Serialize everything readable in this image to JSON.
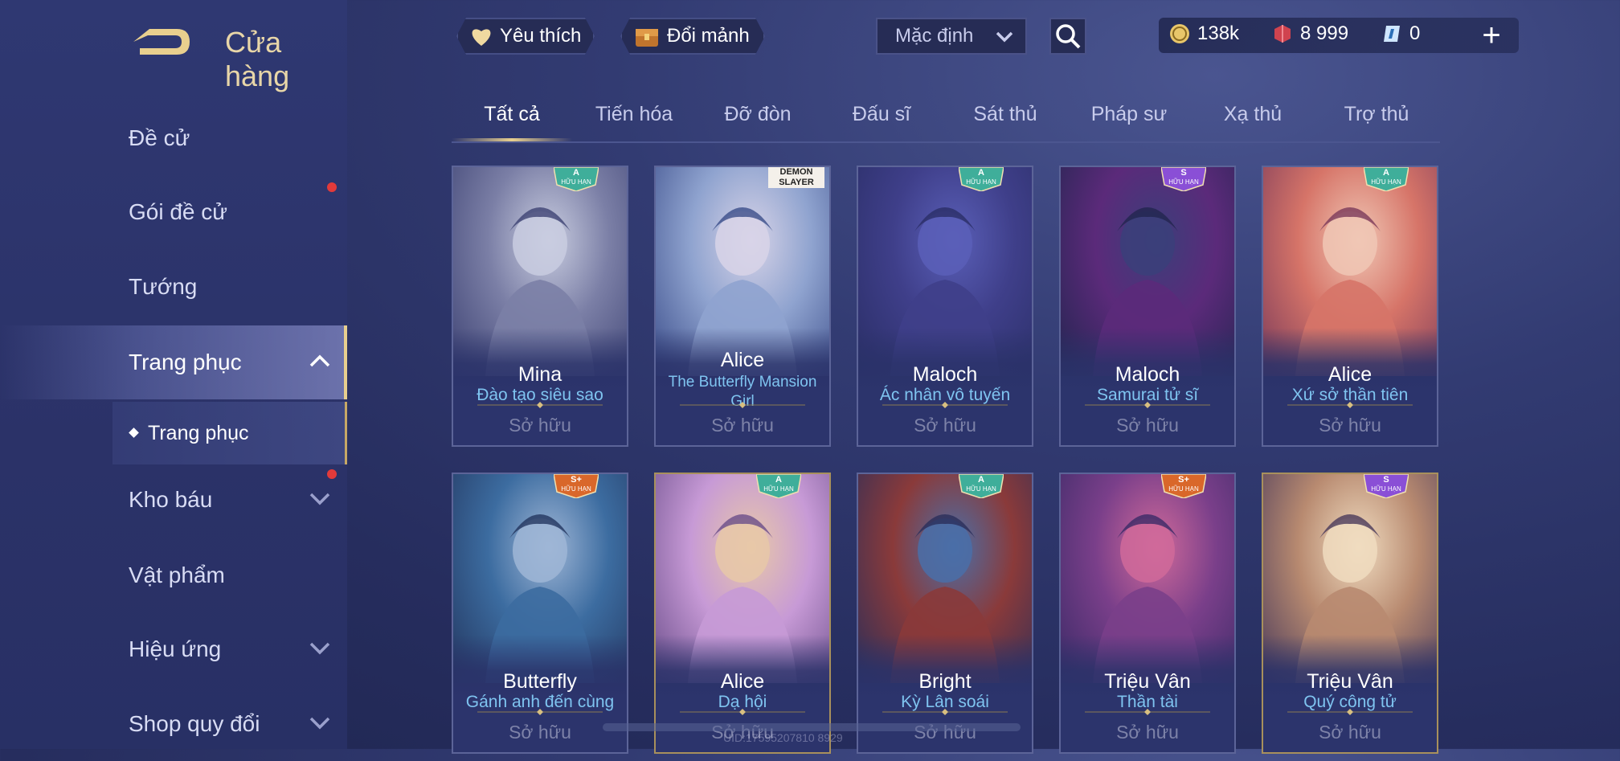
{
  "header": {
    "title": "Cửa hàng",
    "favorite_label": "Yêu thích",
    "exchange_label": "Đổi mảnh",
    "sort_value": "Mặc định",
    "currency": {
      "gold": "138k",
      "vouchers": "8 999",
      "tickets": "0"
    }
  },
  "sidebar": {
    "items": [
      {
        "label": "Đề cử"
      },
      {
        "label": "Gói đề cử"
      },
      {
        "label": "Tướng"
      },
      {
        "label": "Trang phục"
      },
      {
        "label": "Kho báu"
      },
      {
        "label": "Vật phẩm"
      },
      {
        "label": "Hiệu ứng"
      },
      {
        "label": "Shop quy đổi"
      }
    ],
    "subitem": "Trang phục"
  },
  "tabs": [
    "Tất cả",
    "Tiến hóa",
    "Đỡ đòn",
    "Đấu sĩ",
    "Sát thủ",
    "Pháp sư",
    "Xạ thủ",
    "Trợ thủ"
  ],
  "active_tab": "Tất cả",
  "cards": [
    {
      "hero": "Mina",
      "skin": "Đào tạo siêu sao",
      "tier": "A",
      "limited": "HỮU HẠN",
      "status": "Sở hữu"
    },
    {
      "hero": "Alice",
      "skin": "The Butterfly Mansion Girl",
      "tier": "",
      "limited": "",
      "status": "Sở hữu",
      "banner": "DEMON SLAYER"
    },
    {
      "hero": "Maloch",
      "skin": "Ác nhân vô tuyến",
      "tier": "A",
      "limited": "HỮU HẠN",
      "status": "Sở hữu"
    },
    {
      "hero": "Maloch",
      "skin": "Samurai tử sĩ",
      "tier": "S",
      "limited": "HỮU HẠN",
      "status": "Sở hữu"
    },
    {
      "hero": "Alice",
      "skin": "Xứ sở thần tiên",
      "tier": "A",
      "limited": "HỮU HẠN",
      "status": "Sở hữu"
    },
    {
      "hero": "Butterfly",
      "skin": "Gánh anh đến cùng",
      "tier": "S+",
      "limited": "HỮU HẠN",
      "status": "Sở hữu"
    },
    {
      "hero": "Alice",
      "skin": "Dạ hội",
      "tier": "A",
      "limited": "HỮU HẠN",
      "status": "Sở hữu"
    },
    {
      "hero": "Bright",
      "skin": "Kỳ Lân soái",
      "tier": "A",
      "limited": "HỮU HẠN",
      "status": "Sở hữu"
    },
    {
      "hero": "Triệu Vân",
      "skin": "Thần tài",
      "tier": "S+",
      "limited": "HỮU HẠN",
      "status": "Sở hữu"
    },
    {
      "hero": "Triệu Vân",
      "skin": "Quý công tử",
      "tier": "S",
      "limited": "HỮU HẠN",
      "status": "Sở hữu"
    }
  ],
  "watermark": "UID:17595207810 8929",
  "colors": {
    "accent_gold": "#e8cf8e",
    "skin_blue": "#7fc4f0",
    "tier_a": "#3fae9a",
    "tier_s": "#8a4fd6",
    "tier_splus": "#d9672a"
  }
}
